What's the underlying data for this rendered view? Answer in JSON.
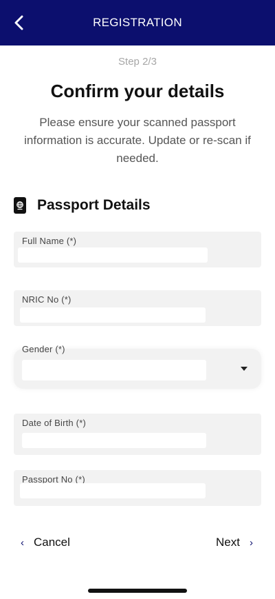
{
  "header": {
    "title": "REGISTRATION",
    "back_icon": "chevron-left-icon",
    "background": "#0c0f6e"
  },
  "step": "Step 2/3",
  "heading": "Confirm your details",
  "description": "Please ensure your scanned passport information is accurate. Update or re-scan if needed.",
  "section": {
    "icon": "passport-icon",
    "title": "Passport Details"
  },
  "fields": {
    "full_name": {
      "label": "Full Name (*)",
      "value": ""
    },
    "nric": {
      "label": "NRIC No (*)",
      "value": ""
    },
    "gender": {
      "label": "Gender (*)",
      "value": ""
    },
    "dob": {
      "label": "Date of Birth (*)",
      "value": ""
    },
    "passport": {
      "label": "Passport No (*)",
      "value": ""
    }
  },
  "nav": {
    "cancel": "Cancel",
    "next": "Next"
  }
}
